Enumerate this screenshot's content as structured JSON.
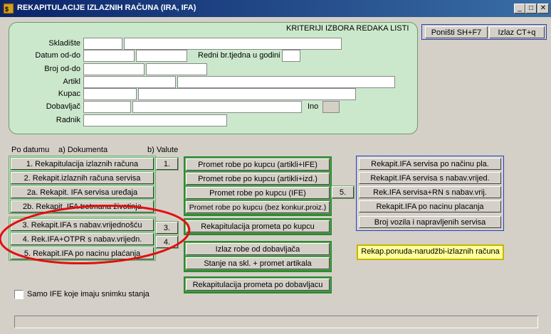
{
  "window": {
    "title": "REKAPITULACIJE IZLAZNIH RAČUNA (IRA, IFA)",
    "minimize": "_",
    "maximize": "□",
    "close": "✕"
  },
  "toolbar": {
    "reset_label": "Poništi SH+F7",
    "exit_label": "Izlaz CT+q"
  },
  "criteria": {
    "heading": "KRITERIJI IZBORA REDAKA LISTI",
    "skladiste_label": "Skladište",
    "datum_label": "Datum od-do",
    "redni_label": "Redni br.tjedna u godini",
    "broj_label": "Broj od-do",
    "artikl_label": "Artikl",
    "kupac_label": "Kupac",
    "dobavljac_label": "Dobavljač",
    "ino_label": "Ino",
    "radnik_label": "Radnik"
  },
  "sections": {
    "po_datumu": "Po datumu",
    "dokumenta": "a) Dokumenta",
    "valute": "b) Valute"
  },
  "col1": {
    "b1": "1. Rekapitulacija izlaznih računa",
    "b2": "2. Rekapit.izlaznih računa servisa",
    "b3": "2a. Rekapit. IFA servisa uređaja",
    "b4": "2b. Rekapit. IFA tretmana životinja",
    "b5": "3. Rekapit.IFA s nabav.vrijednošću",
    "b6": "4. Rek.IFA+OTPR s nabav.vrijedn.",
    "b7": "5. Rekapit.IFA po nacinu plaćanja"
  },
  "valute": {
    "v1": "1.",
    "v3": "3.",
    "v4": "4."
  },
  "col2": {
    "b1": "Promet robe po kupcu (artikli+IFE)",
    "b2": "Promet robe po kupcu (artikli+izd.)",
    "b3": "Promet robe po kupcu (IFE)",
    "b4": "Promet robe po kupcu (bez konkur.proiz.)",
    "b5": "Rekapitulacija prometa po kupcu",
    "b6": "Izlaz robe od dobavljača",
    "b7": "Stanje na skl. + promet artikala",
    "b8": "Rekapitulacija prometa po dobavljacu",
    "v5": "5."
  },
  "col3": {
    "b1": "Rekapit.IFA servisa po načinu pla.",
    "b2": "Rekapit.IFA servisa s nabav.vrijed.",
    "b3": "Rek.IFA servisa+RN s nabav.vrij.",
    "b4": "Rekapit.IFA po nacinu placanja",
    "b5": "Broj vozila i napravljenih servisa",
    "yellow": "Rekap.ponuda-narudžbi-izlaznih računa"
  },
  "footer": {
    "checkbox_label": "Samo IFE koje imaju snimku stanja"
  },
  "colors": {
    "title_gradient_start": "#0a246a",
    "panel_green": "#cce8cc",
    "group_green": "#2e8b2e",
    "group_blue": "#2040c0",
    "highlight_yellow": "#ffff99",
    "annotation_red": "#e01010"
  }
}
